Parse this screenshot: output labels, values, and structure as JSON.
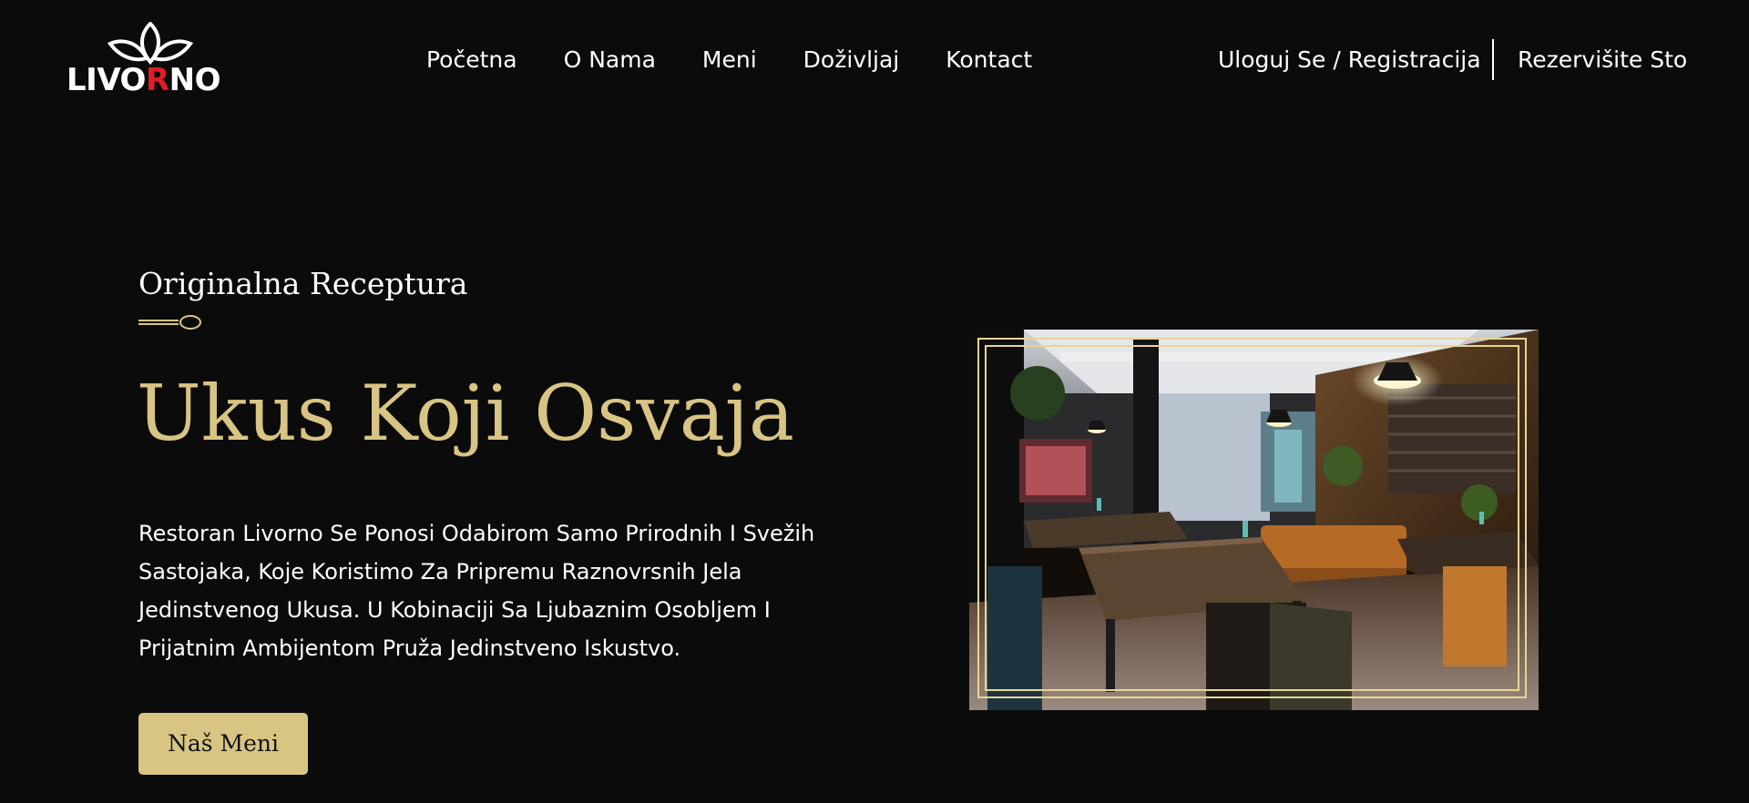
{
  "header": {
    "logo": {
      "text_before": "LIVO",
      "text_accent": "R",
      "text_after": "NO",
      "accent_color": "#e11d24"
    },
    "nav": [
      {
        "label": "Početna"
      },
      {
        "label": "O Nama"
      },
      {
        "label": "Meni"
      },
      {
        "label": "Doživljaj"
      },
      {
        "label": "Kontact"
      }
    ],
    "login_label": "Uloguj Se / Registracija",
    "reserve_label": "Rezervišite Sto"
  },
  "hero": {
    "kicker": "Originalna Receptura",
    "kicker_icon": "spoon-icon",
    "title": "Ukus Koji Osvaja",
    "description": "Restoran Livorno Se Ponosi Odabirom Samo Prirodnih I Svežih Sastojaka, Koje Koristimo Za Pripremu Raznovrsnih Jela Jedinstvenog Ukusa. U Kobinaciji Sa Ljubaznim Osobljem I Prijatnim Ambijentom Pruža Jedinstveno Iskustvo.",
    "button_label": "Naš Meni"
  },
  "colors": {
    "background": "#0b0b0b",
    "gold": "#d8c583",
    "frame": "#e6d595",
    "text": "#ffffff"
  }
}
